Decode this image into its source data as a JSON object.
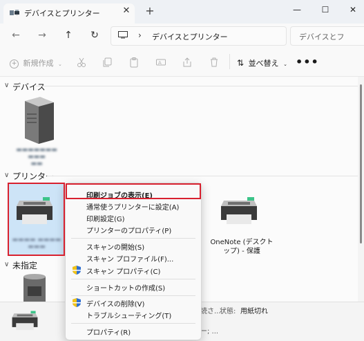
{
  "window": {
    "tab_title": "デバイスとプリンター",
    "tab_close": "✕",
    "new_tab": "+",
    "minimize": "—",
    "maximize": "☐",
    "close": "✕"
  },
  "address_bar": {
    "back": "←",
    "forward": "→",
    "up": "↑",
    "refresh": "↻",
    "separator": "›",
    "path": "デバイスとプリンター",
    "search_placeholder": "デバイスとフ"
  },
  "command_bar": {
    "new_label": "新規作成",
    "new_icon": "plus-circle-icon",
    "sort_label": "並べ替え",
    "more": "•••"
  },
  "groups": {
    "devices": {
      "label": "デバイス"
    },
    "printers": {
      "label": "プリンター"
    },
    "unspecified": {
      "label": "未指定"
    }
  },
  "printers": {
    "onenote_line1": "OneNote (デスクト",
    "onenote_line2": "ップ) - 保護"
  },
  "details": {
    "fragment1": "読さ...",
    "status_label": "状態:",
    "status_value": "用紙切れ",
    "fragment2": "ー; ..."
  },
  "context_menu": {
    "items": [
      "印刷ジョブの表示(E)",
      "通常使うプリンターに設定(A)",
      "印刷設定(G)",
      "プリンターのプロパティ(P)",
      "スキャンの開始(S)",
      "スキャン プロファイル(F)...",
      "スキャン プロパティ(C)",
      "ショートカットの作成(S)",
      "デバイスの削除(V)",
      "トラブルシューティング(T)",
      "プロパティ(R)"
    ]
  },
  "colors": {
    "highlight": "#d8202e",
    "accent": "#0067c0",
    "printer_light": "#3cc489"
  }
}
